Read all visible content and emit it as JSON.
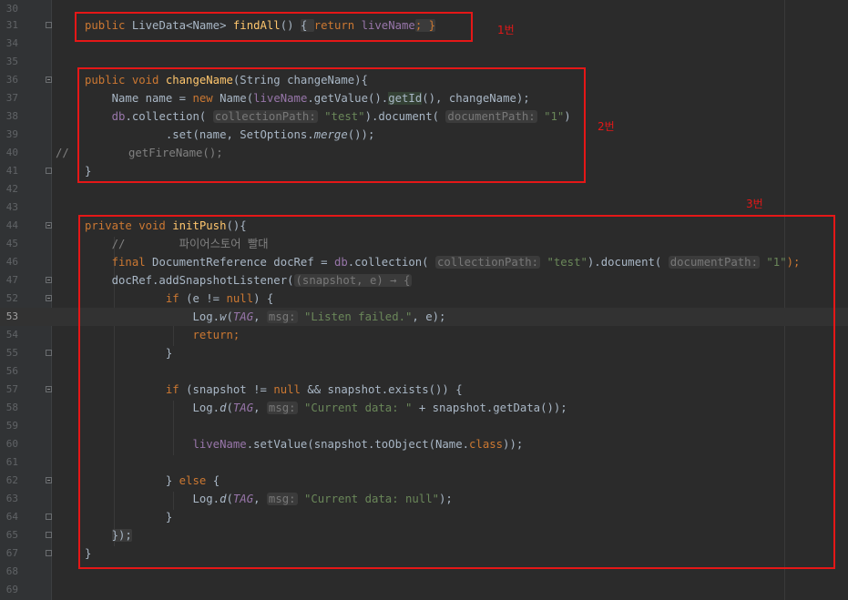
{
  "editor": {
    "line_numbers": [
      "30",
      "31",
      "34",
      "35",
      "36",
      "37",
      "38",
      "39",
      "40",
      "41",
      "42",
      "43",
      "44",
      "45",
      "46",
      "47",
      "52",
      "53",
      "54",
      "55",
      "56",
      "57",
      "58",
      "59",
      "60",
      "61",
      "62",
      "63",
      "64",
      "65",
      "67",
      "68",
      "69"
    ],
    "current_line": "53",
    "code": {
      "l31": {
        "a": "public ",
        "b": "LiveData<Name> ",
        "c": "findAll",
        "d": "() ",
        "e": "{ ",
        "f": "return ",
        "g": "liveName",
        "h": "; }"
      },
      "l36": {
        "a": "public void ",
        "b": "changeName",
        "c": "(String changeName){"
      },
      "l37": {
        "a": "    Name name = ",
        "b": "new ",
        "c": "Name(",
        "d": "liveName",
        "e": ".getValue().",
        "f": "getId",
        "g": "(), changeName);"
      },
      "l38": {
        "a": "    ",
        "b": "db",
        "c": ".collection( ",
        "d": "collectionPath:",
        "e": " ",
        "f": "\"test\"",
        "g": ").document( ",
        "h": "documentPath:",
        "i": " ",
        "j": "\"1\"",
        "k": ")"
      },
      "l39": {
        "a": "            .set(name, SetOptions.",
        "b": "merge",
        "c": "());"
      },
      "l40": {
        "slashes": "//",
        "a": "getFireName();"
      },
      "l41": {
        "a": "}"
      },
      "l44": {
        "a": "private void ",
        "b": "initPush",
        "c": "(){"
      },
      "l45": {
        "a": "    //        파이어스토어 빨대"
      },
      "l46": {
        "a": "    ",
        "b": "final ",
        "c": "DocumentReference docRef = ",
        "d": "db",
        "e": ".collection( ",
        "f": "collectionPath:",
        "g": " ",
        "h": "\"test\"",
        "i": ").document( ",
        "j": "documentPath:",
        "k": " ",
        "l": "\"1\"",
        "m": ");"
      },
      "l47": {
        "a": "    docRef.addSnapshotListener(",
        "b": "(snapshot, e) → {"
      },
      "l52": {
        "a": "            ",
        "b": "if ",
        "c": "(e != ",
        "d": "null",
        "e": ") {"
      },
      "l53": {
        "a": "                Log.",
        "b": "w",
        "c": "(",
        "d": "TAG",
        ",": ", ",
        "e": "msg:",
        "f": " ",
        "g": "\"Listen failed.\"",
        "h": ", e);"
      },
      "l54": {
        "a": "                ",
        "b": "return;"
      },
      "l55": {
        "a": "            }"
      },
      "l57": {
        "a": "            ",
        "b": "if ",
        "c": "(snapshot != ",
        "d": "null ",
        "e": "&& snapshot.exists()) {"
      },
      "l58": {
        "a": "                Log.",
        "b": "d",
        "c": "(",
        "d": "TAG",
        ",": ", ",
        "e": "msg:",
        "f": " ",
        "g": "\"Current data: \"",
        "h": " + snapshot.getData());"
      },
      "l60": {
        "a": "                ",
        "b": "liveName",
        "c": ".setValue(snapshot.toObject(Name.",
        "d": "class",
        "e": "));"
      },
      "l62": {
        "a": "            } ",
        "b": "else ",
        "c": "{"
      },
      "l63": {
        "a": "                Log.",
        "b": "d",
        "c": "(",
        "d": "TAG",
        ",": ", ",
        "e": "msg:",
        "f": " ",
        "g": "\"Current data: null\"",
        "h": ");"
      },
      "l64": {
        "a": "            }"
      },
      "l65": {
        "a": "    ",
        "b": "});"
      },
      "l67": {
        "a": "}"
      }
    }
  },
  "annotations": {
    "box1_label": "1번",
    "box2_label": "2번",
    "box3_label": "3번",
    "box_color": "#e51717"
  }
}
